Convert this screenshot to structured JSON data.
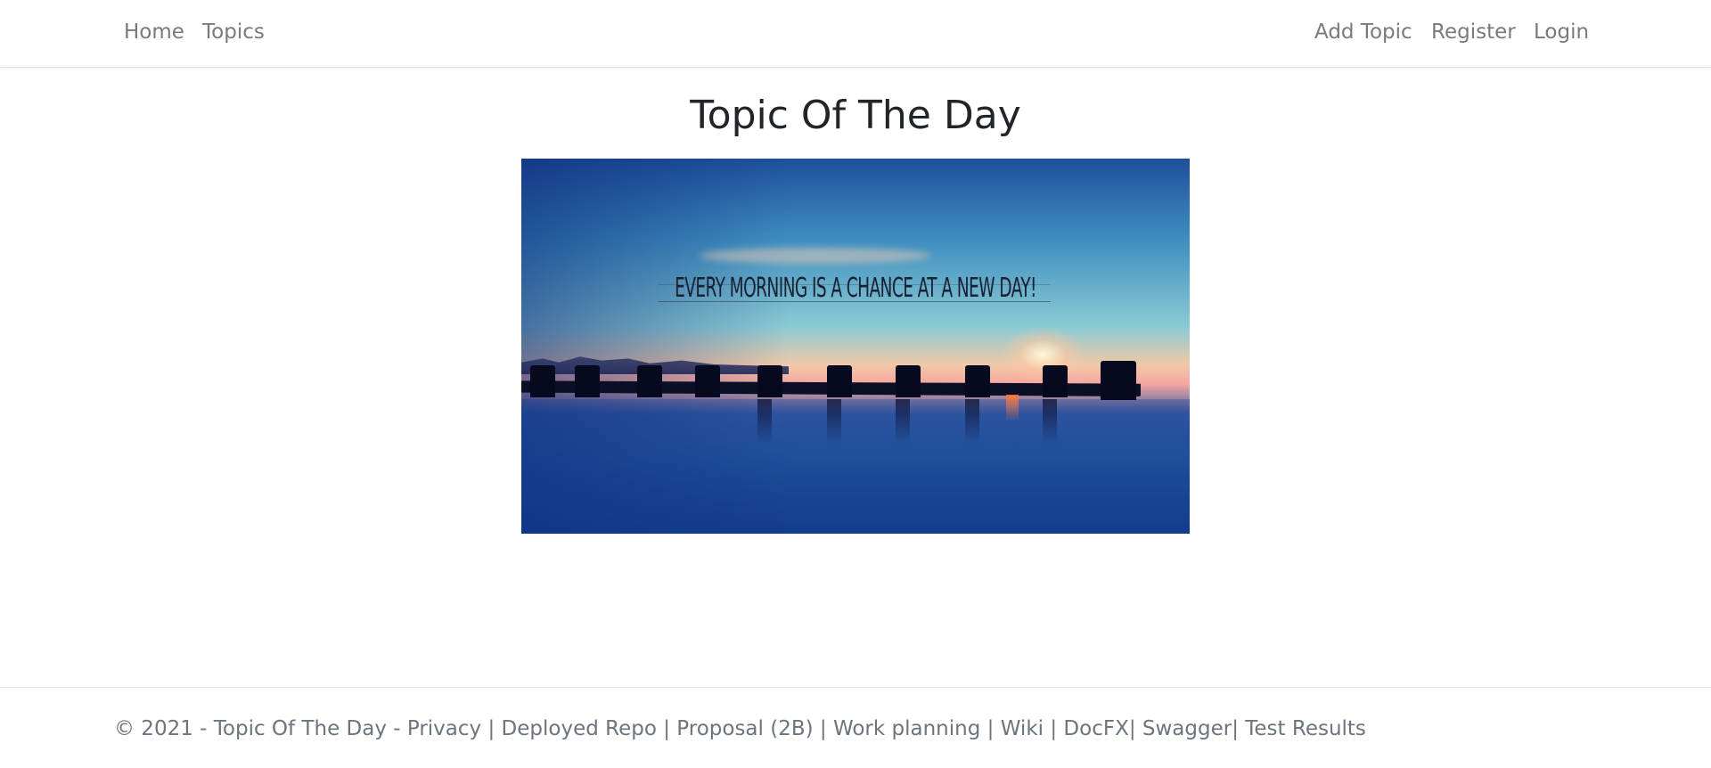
{
  "nav": {
    "left": [
      {
        "label": "Home"
      },
      {
        "label": "Topics"
      }
    ],
    "right": [
      {
        "label": "Add Topic"
      },
      {
        "label": "Register"
      },
      {
        "label": "Login"
      }
    ]
  },
  "main": {
    "title": "Topic Of The Day",
    "hero_caption": "EVERY MORNING IS A CHANCE AT A NEW DAY!"
  },
  "footer": {
    "copyright": "© 2021 - Topic Of The Day - ",
    "sep": " | ",
    "links": {
      "privacy": "Privacy",
      "deployed_repo": "Deployed Repo",
      "proposal": "Proposal (2B)",
      "work_planning": "Work planning",
      "wiki": "Wiki",
      "docfx": "DocFX",
      "swagger": "Swagger",
      "test_results": "Test Results"
    },
    "pipe": "|"
  },
  "colors": {
    "nav_link": "#7a7a7a",
    "title": "#212529",
    "footer_text": "#6c757d"
  }
}
